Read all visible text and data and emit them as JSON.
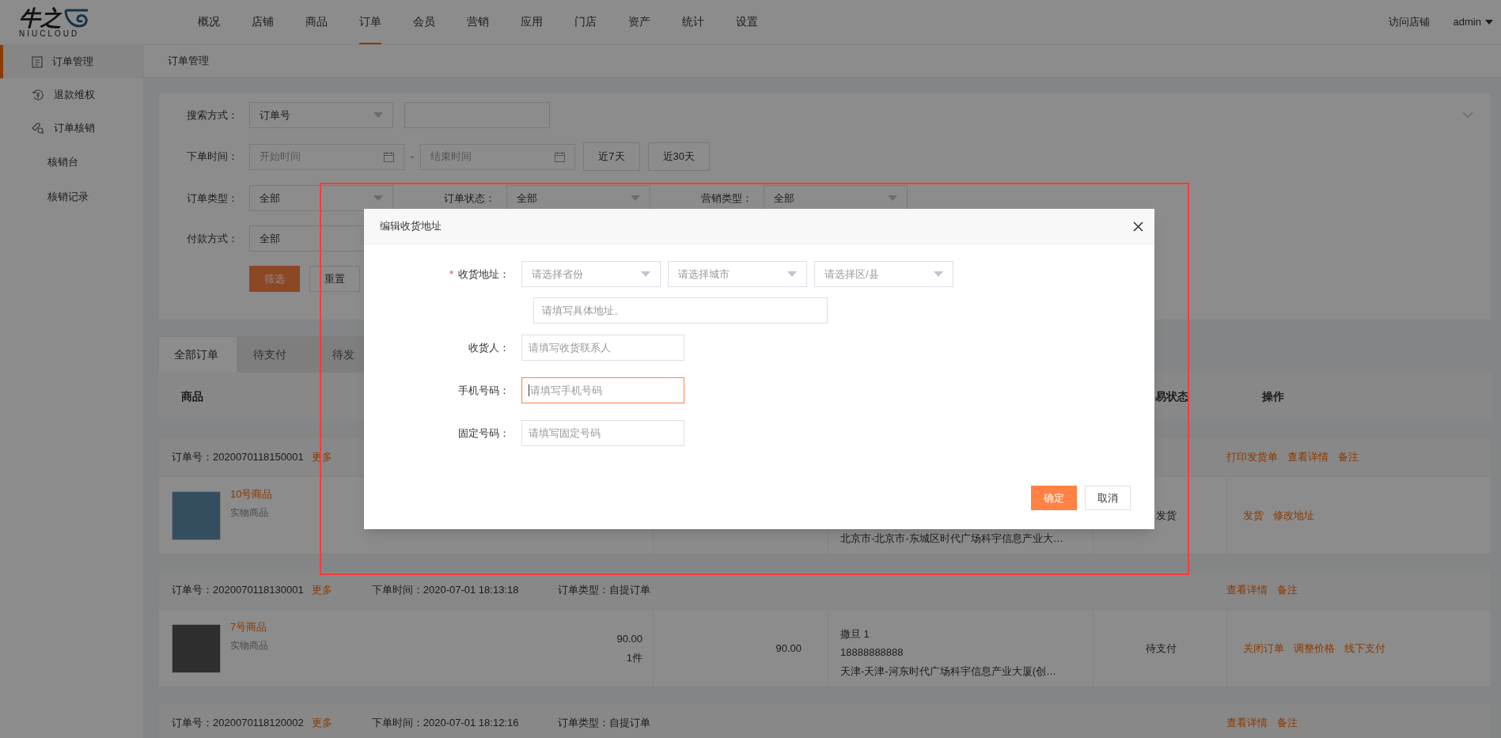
{
  "header": {
    "logo": {
      "mark": "牛之",
      "sub": "NIUCLOUD"
    },
    "nav": [
      {
        "label": "概况",
        "selected": false
      },
      {
        "label": "店铺",
        "selected": false
      },
      {
        "label": "商品",
        "selected": false
      },
      {
        "label": "订单",
        "selected": true
      },
      {
        "label": "会员",
        "selected": false
      },
      {
        "label": "营销",
        "selected": false
      },
      {
        "label": "应用",
        "selected": false
      },
      {
        "label": "门店",
        "selected": false
      },
      {
        "label": "资产",
        "selected": false
      },
      {
        "label": "统计",
        "selected": false
      },
      {
        "label": "设置",
        "selected": false
      }
    ],
    "visit_store": "访问店铺",
    "user": "admin"
  },
  "sidebar": {
    "items": [
      {
        "label": "订单管理",
        "selected": true
      },
      {
        "label": "退款维权",
        "selected": false
      },
      {
        "label": "订单核销",
        "selected": false,
        "children": [
          {
            "label": "核销台",
            "selected": false
          },
          {
            "label": "核销记录",
            "selected": false
          }
        ]
      }
    ]
  },
  "breadcrumb": "订单管理",
  "filters": {
    "search_method": {
      "label": "搜索方式：",
      "value": "订单号"
    },
    "order_time": {
      "label": "下单时间：",
      "start_placeholder": "开始时间",
      "separator": "-",
      "end_placeholder": "结束时间",
      "quick": [
        "近7天",
        "近30天"
      ]
    },
    "order_type": {
      "label": "订单类型：",
      "value": "全部"
    },
    "order_status": {
      "label": "订单状态：",
      "value": "全部"
    },
    "promo_type": {
      "label": "营销类型：",
      "value": "全部"
    },
    "payment": {
      "label": "付款方式：",
      "value": "全部"
    },
    "submit": "筛选",
    "reset": "重置"
  },
  "tabs": [
    {
      "label": "全部订单",
      "selected": true
    },
    {
      "label": "待支付",
      "selected": false
    },
    {
      "label": "待发",
      "selected": false
    }
  ],
  "table": {
    "columns": {
      "product": "商品",
      "status": "易状态",
      "actions": "操作"
    },
    "orders": [
      {
        "order_no": "订单号：2020070118150001",
        "more": "更多",
        "header_actions": [
          "打印发货单",
          "查看详情",
          "备注"
        ],
        "product": "10号商品",
        "product_type": "实物商品",
        "address": "北京市-北京市-东城区时代广场科宇信息产业大…",
        "status": "发货",
        "actions": [
          "发货",
          "修改地址"
        ]
      },
      {
        "order_no": "订单号：2020070118130001",
        "more": "更多",
        "time": "下单时间：2020-07-01 18:13:18",
        "order_type": "订单类型：自提订单",
        "header_actions": [
          "查看详情",
          "备注"
        ],
        "product": "7号商品",
        "product_type": "实物商品",
        "price": "90.00",
        "quantity": "1件",
        "total": "90.00",
        "buyer": "撒旦 1",
        "phone": "18888888888",
        "address": "天津-天津-河东时代广场科宇信息产业大厦(创…",
        "status": "待支付",
        "actions": [
          "关闭订单",
          "调整价格",
          "线下支付"
        ]
      },
      {
        "order_no": "订单号：2020070118120002",
        "more": "更多",
        "time": "下单时间：2020-07-01 18:12:16",
        "order_type": "订单类型：自提订单",
        "header_actions": [
          "查看详情",
          "备注"
        ]
      }
    ]
  },
  "modal": {
    "title": "编辑收货地址",
    "address": {
      "required": "*",
      "label": "收货地址：",
      "selects": [
        "请选择省份",
        "请选择城市",
        "请选择区/县"
      ],
      "detail_placeholder": "请填写具体地址。"
    },
    "fields": [
      {
        "label": "收货人：",
        "placeholder": "请填写收货联系人",
        "focused": false
      },
      {
        "label": "手机号码：",
        "placeholder": "请填写手机号码",
        "focused": true
      },
      {
        "label": "固定号码：",
        "placeholder": "请填写固定号码",
        "focused": false
      }
    ],
    "confirm": "确定",
    "cancel": "取消"
  },
  "annotation": {
    "frame": true
  }
}
